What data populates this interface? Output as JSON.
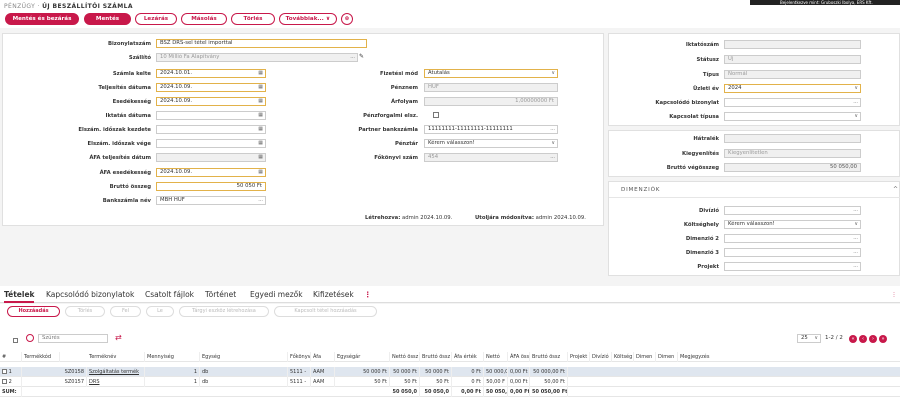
{
  "header": {
    "module": "PÉNZÜGY",
    "separator": " · ",
    "title": "ÚJ BESZÁLLÍTÓI SZÁMLA",
    "user": "Bejelentkezve mint: Gruboszki Ibolya, ERS Kft."
  },
  "toolbar": {
    "save_close": "Mentés és bezárás",
    "save": "Mentés",
    "lock": "Lezárás",
    "copy": "Másolás",
    "delete": "Törlés",
    "more": "Továbbiak...",
    "more_caret": "∨",
    "icon_name": "delete-bin-icon",
    "icon_glyph": "⊗"
  },
  "form": {
    "voucher_label": "Bizonylatszám",
    "voucher_value": "BSZ DRS-sel tétel importtal",
    "supplier_label": "Szállító",
    "supplier_value": "10 Millió Fa Alapítvány",
    "supplier_more": "...",
    "supplier_edit": "✎",
    "invoice_date_label": "Számla kelte",
    "invoice_date_value": "2024.10.01.",
    "fulfilment_label": "Teljesítés dátuma",
    "fulfilment_value": "2024.10.09.",
    "due_label": "Esedékesség",
    "due_value": "2024.10.09.",
    "filing_label": "Iktatás dátuma",
    "filing_value": "",
    "period_start_label": "Elszám. időszak kezdete",
    "period_start_value": "",
    "period_end_label": "Elszám. időszak vége",
    "period_end_value": "",
    "vat_fulfil_label": "ÁFA teljesítés dátum",
    "vat_fulfil_value": "",
    "vat_due_label": "ÁFA esedékesség",
    "vat_due_value": "2024.10.09.",
    "gross_label": "Bruttó összeg",
    "gross_value": "50 050 Ft",
    "bank_label": "Bankszámla név",
    "bank_value": "MBH HUF",
    "bank_more": "...",
    "cal_glyph": "▦",
    "pay_mode_label": "Fizetési mód",
    "pay_mode_value": "Átutalás",
    "currency_label": "Pénznem",
    "currency_value": "HUF",
    "rate_label": "Árfolyam",
    "rate_value": "1,00000000 Ft",
    "cashflow_label": "Pénzforgalmi elsz.",
    "partner_bank_label": "Partner bankszámla",
    "partner_bank_value": "11111111-11111111-11111111",
    "partner_bank_more": "...",
    "cashdesk_label": "Pénztár",
    "cashdesk_value": "Kérem válasszon!",
    "ledger_label": "Főkönyvi szám",
    "ledger_value": "454",
    "ledger_more": "...",
    "caret": "∨",
    "created_label": "Létrehozva:",
    "created_value": "admin 2024.10.09.",
    "modified_label": "Utoljára módosítva:",
    "modified_value": "admin 2024.10.09."
  },
  "side": {
    "file_no_label": "Iktatószám",
    "file_no_value": "",
    "status_label": "Státusz",
    "status_value": "Új",
    "type_label": "Típus",
    "type_value": "Normál",
    "fiscal_year_label": "Üzleti év",
    "fiscal_year_value": "2024",
    "related_doc_label": "Kapcsolódó bizonylat",
    "related_doc_value": "...",
    "relation_type_label": "Kapcsolat típusa",
    "relation_type_value": "",
    "arrears_label": "Hátralék",
    "arrears_value": "",
    "settlement_label": "Kiegyenlítés",
    "settlement_value": "Kiegyenlítetlen",
    "gross_total_label": "Bruttó végösszeg",
    "gross_total_value": "50 050,00",
    "dimensions_title": "DIMENZIÓK",
    "dim_collapse": "^",
    "division_label": "Divízió",
    "division_value": "...",
    "cost_center_label": "Költséghely",
    "cost_center_value": "Kérem válasszon!",
    "dim2_label": "Dimenzió 2",
    "dim2_value": "...",
    "dim3_label": "Dimenzió 3",
    "dim3_value": "...",
    "project_label": "Projekt",
    "project_value": "..."
  },
  "tabs": {
    "items": [
      "Tételek",
      "Kapcsolódó bizonylatok",
      "Csatolt fájlok",
      "Történet",
      "Egyedi mezők",
      "Kifizetések"
    ],
    "more": "⋮",
    "filter_glyph": "⫶"
  },
  "grid_toolbar": {
    "add": "Hozzáadás",
    "delete": "Törlés",
    "up": "Fel",
    "down": "Le",
    "create_asset": "Tárgyi eszköz létrehozása",
    "link_items": "Kapcsolt tétel hozzáadás",
    "filter_placeholder": "Szűrés",
    "page_size": "25",
    "page_info": "1-2 / 2",
    "nav_first": "«",
    "nav_prev": "‹",
    "nav_next": "›",
    "nav_last": "»"
  },
  "grid": {
    "columns": [
      "#",
      "Termékkód",
      "Terméknév",
      "Mennyiség",
      "Egység",
      "Főkönyv",
      "Áfa",
      "Egységár",
      "Nettó össz",
      "Bruttó össz",
      "Áfa érték",
      "Nettó",
      "ÁFA össz",
      "Bruttó össz",
      "Projekt",
      "Divízió",
      "Költség",
      "Dimen",
      "Dimen",
      "Megjegyzés"
    ],
    "rows": [
      [
        "1",
        "SZ0158",
        "Szolgáltatás termék",
        "1",
        "db",
        "5111 -",
        "AAM",
        "50 000 Ft",
        "50 000 Ft",
        "50 000 Ft",
        "0 Ft",
        "50 000,0",
        "0,00 Ft",
        "50 000,00 Ft",
        "",
        "",
        "",
        "",
        "",
        ""
      ],
      [
        "2",
        "SZ0157",
        "DRS",
        "1",
        "db",
        "5111 -",
        "AAM",
        "50 Ft",
        "50 Ft",
        "50 Ft",
        "0 Ft",
        "50,00 F",
        "0,00 Ft",
        "50,00 Ft",
        "",
        "",
        "",
        "",
        "",
        ""
      ]
    ],
    "sum": [
      "SUM:",
      "",
      "",
      "",
      "",
      "",
      "",
      "",
      "50 050,0",
      "50 050,0",
      "0,00 Ft",
      "50 050,0",
      "0,00 Ft",
      "50 050,00 Ft",
      "",
      "",
      "",
      "",
      "",
      ""
    ]
  },
  "colors": {
    "accent": "#c8184a",
    "required_border": "#e2b24a",
    "selected_row": "#dfe6ef"
  }
}
